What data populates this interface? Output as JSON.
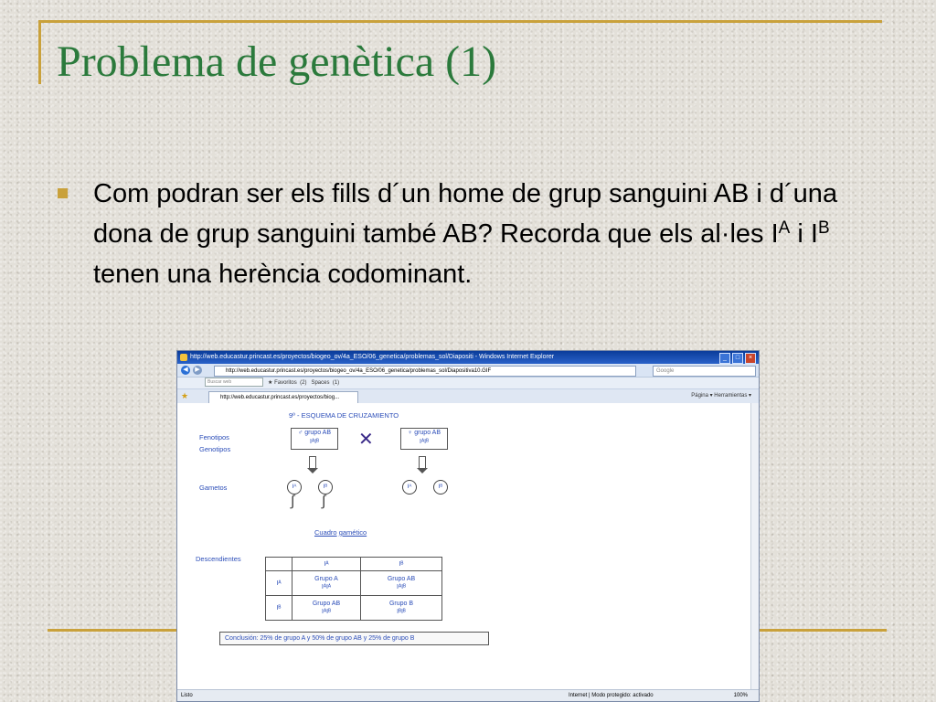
{
  "slide": {
    "title": "Problema de genètica (1)",
    "text_part1": "Com podran ser els fills d´un home de grup sanguini AB i d´una dona de grup sanguini també AB? Recorda que els al·les I",
    "sup_a": "A",
    "text_part2": " i I",
    "sup_b": "B",
    "text_part3": " tenen una herència codominant."
  },
  "browser": {
    "title_bar": "http://web.educastur.princast.es/proyectos/biogeo_ov/4a_ESO/06_genetica/problemas_sol/Diapositi - Windows Internet Explorer",
    "address": "http://web.educastur.princast.es/proyectos/biogeo_ov/4a_ESO/06_genetica/problemas_sol/Diapositiva10.GIF",
    "search_placeholder": "Google",
    "links_search": "Buscar web",
    "links_favoritos": "Favoritos",
    "links_count": "(2)",
    "links_spaces": "Spaces",
    "links_count2": "(1)",
    "tab_label": "http://web.educastur.princast.es/proyectos/biog...",
    "tab_tools": "Página ▾  Herramientas ▾",
    "status_left": "Listo",
    "status_zone": "Internet | Modo protegido: activado",
    "status_zoom": "100%"
  },
  "diagram": {
    "heading": "9º - ESQUEMA DE CRUZAMIENTO",
    "fenotipos": "Fenotipos",
    "genotipos": "Genotipos",
    "gametos": "Gametos",
    "descendientes": "Descendientes",
    "male_pheno": "♂ grupo AB",
    "male_geno": "IᴬIᴮ",
    "female_pheno": "♀ grupo AB",
    "female_geno": "IᴬIᴮ",
    "gamete_a": "Iᴬ",
    "gamete_b": "Iᴮ",
    "cuadro": "Cuadro",
    "gametico": "gamético",
    "col_a": "Iᴬ",
    "col_b": "Iᴮ",
    "row_a": "Iᴬ",
    "row_b": "Iᴮ",
    "cell_aa_1": "Grupo A",
    "cell_aa_2": "IᴬIᴬ",
    "cell_ab_1": "Grupo AB",
    "cell_ab_2": "IᴬIᴮ",
    "cell_ba_1": "Grupo AB",
    "cell_ba_2": "IᴬIᴮ",
    "cell_bb_1": "Grupo B",
    "cell_bb_2": "IᴮIᴮ",
    "conclusion": "Conclusión: 25% de grupo A y 50% de grupo AB y 25% de grupo B"
  }
}
